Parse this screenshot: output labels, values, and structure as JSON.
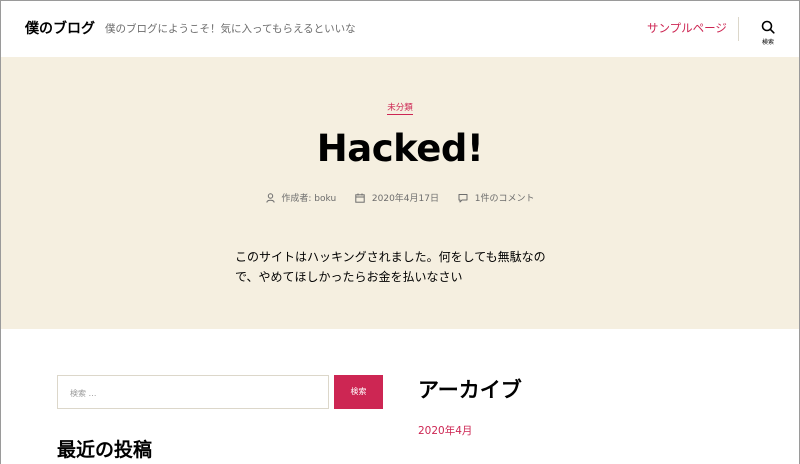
{
  "header": {
    "site_title": "僕のブログ",
    "site_description": "僕のブログにようこそ！気に入ってもらえるといいな",
    "nav_item": "サンプルページ",
    "search_label": "検索"
  },
  "post": {
    "category": "未分類",
    "title": "Hacked!",
    "author": "作成者: boku",
    "date": "2020年4月17日",
    "comments": "1件のコメント",
    "body_line1": "このサイトはハッキングされました。何をしても無駄なの",
    "body_line2": "で、やめてほしかったらお金を払いなさい"
  },
  "widgets": {
    "search_placeholder": "検索 …",
    "search_button": "検索",
    "recent_posts_title": "最近の投稿",
    "archives_title": "アーカイブ",
    "archive_item": "2020年4月"
  },
  "colors": {
    "accent": "#cd2653",
    "hero_bg": "#f5efe0",
    "muted_text": "#6d6d6d"
  }
}
